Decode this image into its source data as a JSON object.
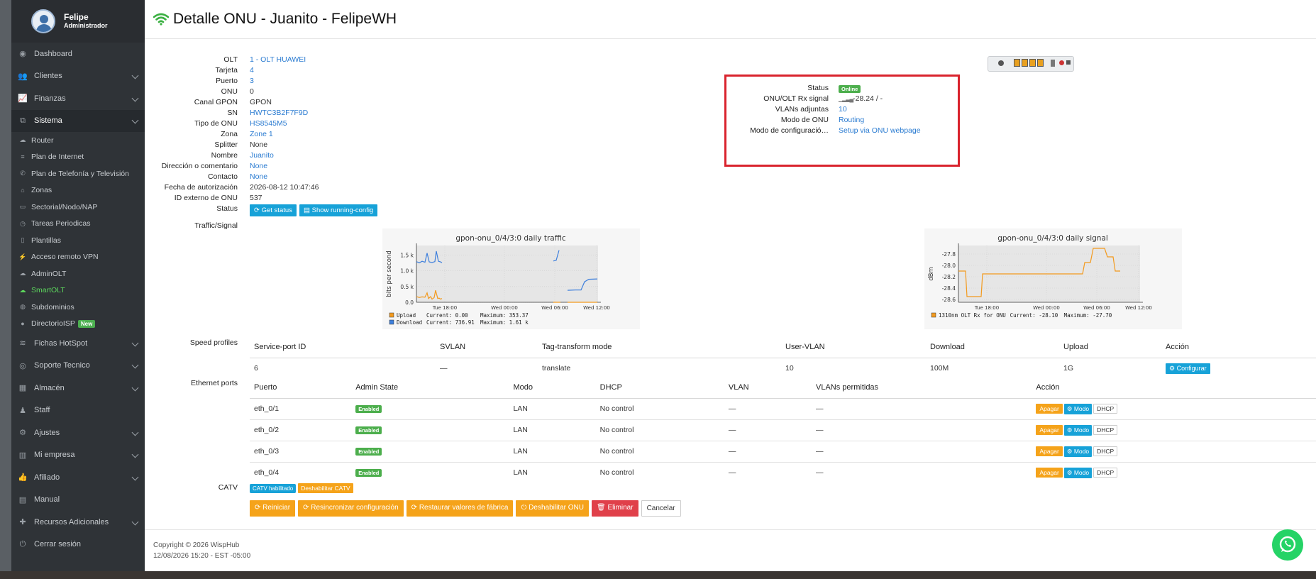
{
  "user": {
    "name": "Felipe",
    "role": "Administrador"
  },
  "nav": [
    {
      "label": "Dashboard",
      "icon": "palette-icon",
      "chev": false
    },
    {
      "label": "Clientes",
      "icon": "users-icon",
      "chev": true
    },
    {
      "label": "Finanzas",
      "icon": "chart-line-icon",
      "chev": true
    },
    {
      "label": "Sistema",
      "icon": "sitemap-icon",
      "chev": true,
      "active": true
    }
  ],
  "subnav": [
    {
      "label": "Router",
      "icon": "cloud-icon"
    },
    {
      "label": "Plan de Internet",
      "icon": "list-icon"
    },
    {
      "label": "Plan de Telefonía y Televisión",
      "icon": "phone-icon"
    },
    {
      "label": "Zonas",
      "icon": "home-icon"
    },
    {
      "label": "Sectorial/Nodo/NAP",
      "icon": "desktop-icon"
    },
    {
      "label": "Tareas Periodicas",
      "icon": "clock-icon"
    },
    {
      "label": "Plantillas",
      "icon": "file-icon"
    },
    {
      "label": "Acceso remoto VPN",
      "icon": "plug-icon"
    },
    {
      "label": "AdminOLT",
      "icon": "cloud-icon"
    },
    {
      "label": "SmartOLT",
      "icon": "cloud-icon",
      "highlight": true
    },
    {
      "label": "Subdominios",
      "icon": "globe-icon"
    },
    {
      "label": "DirectorioISP",
      "icon": "map-marker-icon",
      "badge": "New"
    }
  ],
  "nav2": [
    {
      "label": "Fichas HotSpot",
      "icon": "wifi-icon",
      "chev": true
    },
    {
      "label": "Soporte Tecnico",
      "icon": "life-ring-icon",
      "chev": true
    },
    {
      "label": "Almacén",
      "icon": "archive-icon",
      "chev": true
    },
    {
      "label": "Staff",
      "icon": "person-icon",
      "chev": false
    },
    {
      "label": "Ajustes",
      "icon": "gear-icon",
      "chev": true
    },
    {
      "label": "Mi empresa",
      "icon": "building-icon",
      "chev": true
    },
    {
      "label": "Afiliado",
      "icon": "thumbs-up-icon",
      "chev": true
    },
    {
      "label": "Manual",
      "icon": "book-icon",
      "chev": false
    },
    {
      "label": "Recursos Adicionales",
      "icon": "plus-icon",
      "chev": true
    },
    {
      "label": "Cerrar sesión",
      "icon": "power-icon",
      "chev": false
    }
  ],
  "page": {
    "title": "Detalle ONU - Juanito - FelipeWH"
  },
  "details": [
    {
      "label": "OLT",
      "value": "1 - OLT HUAWEI",
      "link": true
    },
    {
      "label": "Tarjeta",
      "value": "4",
      "link": true
    },
    {
      "label": "Puerto",
      "value": "3",
      "link": true
    },
    {
      "label": "ONU",
      "value": "0",
      "link": false
    },
    {
      "label": "Canal GPON",
      "value": "GPON",
      "link": false
    },
    {
      "label": "SN",
      "value": "HWTC3B2F7F9D",
      "link": true
    },
    {
      "label": "Tipo de ONU",
      "value": "HS8545M5",
      "link": true
    },
    {
      "label": "Zona",
      "value": "Zone 1",
      "link": true
    },
    {
      "label": "Splitter",
      "value": "None",
      "link": false
    },
    {
      "label": "Nombre",
      "value": "Juanito",
      "link": true
    },
    {
      "label": "Dirección o comentario",
      "value": "None",
      "link": true
    },
    {
      "label": "Contacto",
      "value": "None",
      "link": true
    },
    {
      "label": "Fecha de autorización",
      "value": "2026-08-12 10:47:46",
      "link": false
    },
    {
      "label": "ID externo de ONU",
      "value": "537",
      "link": false
    }
  ],
  "status_label": "Status",
  "status_buttons": [
    "Get status",
    "Show running-config"
  ],
  "traffic_label": "Traffic/Signal",
  "status_box": {
    "rows": [
      {
        "label": "Status",
        "value": "Online",
        "type": "badge"
      },
      {
        "label": "ONU/OLT Rx signal",
        "value": "-28.24 / -",
        "type": "signal"
      },
      {
        "label": "VLANs adjuntas",
        "value": "10",
        "type": "link"
      },
      {
        "label": "Modo de ONU",
        "value": "Routing",
        "type": "link"
      },
      {
        "label": "Modo de configuració…",
        "value": "Setup via ONU webpage",
        "type": "link"
      }
    ]
  },
  "chart_data": [
    {
      "type": "line",
      "title": "gpon-onu_0/4/3:0 daily traffic",
      "ylabel": "bits per second",
      "x_ticks": [
        "Tue 18:00",
        "Wed 00:00",
        "Wed 06:00",
        "Wed 12:00"
      ],
      "y_ticks": [
        "1.5 k",
        "1.0 k",
        "0.5 k",
        "0.0"
      ],
      "ylim": [
        0,
        1800
      ],
      "series": [
        {
          "name": "Upload",
          "color": "#f39a1e",
          "current": "0.00",
          "maximum": "353.37",
          "points": [
            [
              0,
              180
            ],
            [
              4,
              150
            ],
            [
              8,
              170
            ],
            [
              12,
              160
            ],
            [
              15,
              300
            ],
            [
              17,
              120
            ],
            [
              20,
              180
            ],
            [
              22,
              100
            ],
            [
              25,
              150
            ],
            [
              27,
              380
            ],
            [
              30,
              120
            ],
            [
              32,
              130
            ],
            [
              34,
              100
            ],
            [
              36,
              120
            ],
            [
              null,
              null
            ],
            [
              193,
              0
            ],
            [
              203,
              0
            ],
            [
              null,
              null
            ],
            [
              213,
              0
            ],
            [
              255,
              0
            ]
          ]
        },
        {
          "name": "Download",
          "color": "#3d7fdc",
          "current": "736.91",
          "maximum": "1.61 k",
          "points": [
            [
              0,
              1290
            ],
            [
              4,
              1250
            ],
            [
              8,
              1300
            ],
            [
              12,
              1270
            ],
            [
              15,
              1560
            ],
            [
              18,
              1280
            ],
            [
              22,
              1260
            ],
            [
              26,
              1290
            ],
            [
              28,
              1620
            ],
            [
              31,
              1300
            ],
            [
              34,
              1280
            ],
            [
              36,
              1250
            ],
            [
              null,
              null
            ],
            [
              193,
              1310
            ],
            [
              197,
              1330
            ],
            [
              201,
              1650
            ],
            [
              null,
              null
            ],
            [
              213,
              380
            ],
            [
              224,
              390
            ],
            [
              232,
              390
            ],
            [
              237,
              650
            ],
            [
              243,
              730
            ],
            [
              255,
              740
            ]
          ]
        }
      ]
    },
    {
      "type": "line",
      "title": "gpon-onu_0/4/3:0 daily signal",
      "ylabel": "dBm",
      "x_ticks": [
        "Tue 18:00",
        "Wed 00:00",
        "Wed 06:00",
        "Wed 12:00"
      ],
      "y_ticks": [
        "-27.8",
        "-28.0",
        "-28.2",
        "-28.4",
        "-28.6"
      ],
      "ylim": [
        -28.65,
        -27.65
      ],
      "series": [
        {
          "name": "1310nm OLT Rx for ONU",
          "color": "#f39a1e",
          "current": "-28.10",
          "maximum": "-27.70",
          "points": [
            [
              0,
              -28.1
            ],
            [
              10,
              -28.1
            ],
            [
              12,
              -28.55
            ],
            [
              32,
              -28.55
            ],
            [
              34,
              -28.15
            ],
            [
              175,
              -28.15
            ],
            [
              178,
              -27.95
            ],
            [
              186,
              -27.95
            ],
            [
              190,
              -27.7
            ],
            [
              206,
              -27.7
            ],
            [
              210,
              -27.85
            ],
            [
              218,
              -27.85
            ],
            [
              221,
              -28.1
            ],
            [
              228,
              -28.1
            ]
          ]
        }
      ]
    }
  ],
  "speed": {
    "label": "Speed profiles",
    "headers": [
      "Service-port ID",
      "SVLAN",
      "Tag-transform mode",
      "User-VLAN",
      "Download",
      "Upload",
      "Acción"
    ],
    "rows": [
      [
        "6",
        "—",
        "translate",
        "10",
        "100M",
        "1G",
        "Configurar"
      ]
    ]
  },
  "eth": {
    "label": "Ethernet ports",
    "headers": [
      "Puerto",
      "Admin State",
      "Modo",
      "DHCP",
      "VLAN",
      "VLANs permitidas",
      "Acción"
    ],
    "rows": [
      {
        "port": "eth_0/1",
        "state": "Enabled",
        "mode": "LAN",
        "dhcp": "No control",
        "vlan": "—",
        "allowed": "—"
      },
      {
        "port": "eth_0/2",
        "state": "Enabled",
        "mode": "LAN",
        "dhcp": "No control",
        "vlan": "—",
        "allowed": "—"
      },
      {
        "port": "eth_0/3",
        "state": "Enabled",
        "mode": "LAN",
        "dhcp": "No control",
        "vlan": "—",
        "allowed": "—"
      },
      {
        "port": "eth_0/4",
        "state": "Enabled",
        "mode": "LAN",
        "dhcp": "No control",
        "vlan": "—",
        "allowed": "—"
      }
    ],
    "actions": [
      "Apagar",
      "Modo",
      "DHCP"
    ]
  },
  "catv": {
    "label": "CATV",
    "badge": "CATV habilitado",
    "button": "Deshabilitar CATV"
  },
  "actions": [
    "Reiniciar",
    "Resincronizar configuración",
    "Restaurar valores de fábrica",
    "Deshabilitar ONU",
    "Eliminar",
    "Cancelar"
  ],
  "footer": {
    "copyright": "Copyright © 2026 WispHub",
    "datetime": "12/08/2026 15:20 - EST -05:00"
  },
  "colors": {
    "sidebar": "#2f3337",
    "link": "#2a7bd1",
    "online": "#4cae4c",
    "orange": "#f5a31a",
    "blue": "#17a2d8",
    "red": "#e0404a",
    "highlight_box": "#d9232d"
  }
}
